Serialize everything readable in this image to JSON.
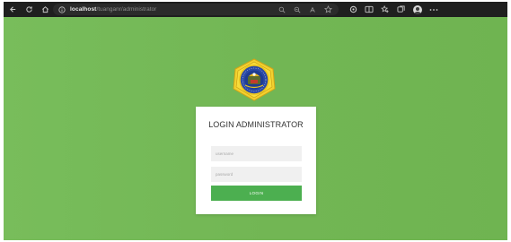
{
  "browser": {
    "url_host": "localhost",
    "url_path": "/tuanganr/administrator"
  },
  "icons": {
    "back": "back-arrow-icon",
    "reload": "reload-icon",
    "home": "home-icon",
    "site_info": "info-icon",
    "zoom": "zoom-icon",
    "read_aloud": "read-aloud-icon",
    "favorite": "star-icon",
    "extensions": "extensions-icon",
    "split_screen": "split-screen-icon",
    "favorites_bar": "favorites-icon",
    "collections": "collections-icon",
    "profile": "profile-icon",
    "more": "more-icon"
  },
  "login": {
    "title": "LOGIN ADMINISTRATOR",
    "username_placeholder": "username",
    "password_placeholder": "password",
    "button_label": "LOGIN"
  },
  "colors": {
    "page_background": "#72b654",
    "button": "#4caf50",
    "browser_chrome": "#1f1f1f"
  }
}
